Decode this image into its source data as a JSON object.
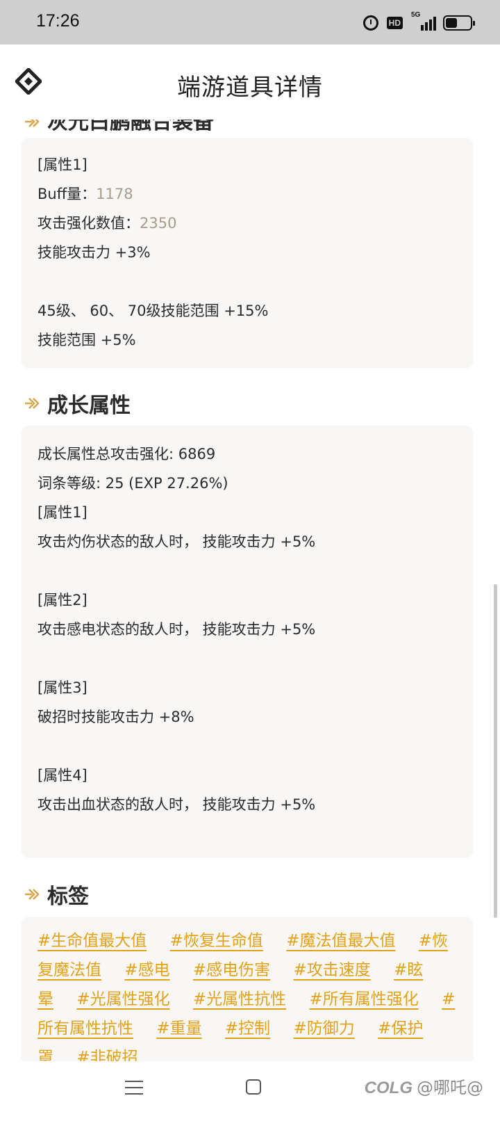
{
  "status": {
    "time": "17:26",
    "hd": "HD",
    "network": "5G"
  },
  "header": {
    "title": "端游道具详情"
  },
  "cut_heading": "灰光白鹏融合装备",
  "card1": {
    "lines": [
      {
        "label": "[属性1]",
        "value": ""
      },
      {
        "label": "Buff量：",
        "value": "1178"
      },
      {
        "label": "攻击强化数值：",
        "value": "2350"
      },
      {
        "label": "技能攻击力 +3%",
        "value": ""
      },
      {
        "label": "",
        "value": ""
      },
      {
        "label": "45级、 60、 70级技能范围 +15%",
        "value": ""
      },
      {
        "label": "技能范围 +5%",
        "value": ""
      }
    ]
  },
  "growth": {
    "title": "成长属性",
    "lines": [
      "成长属性总攻击强化: 6869",
      "词条等级: 25 (EXP 27.26%)",
      "[属性1]",
      "攻击灼伤状态的敌人时， 技能攻击力 +5%",
      "",
      "[属性2]",
      "攻击感电状态的敌人时， 技能攻击力 +5%",
      "",
      "[属性3]",
      "破招时技能攻击力 +8%",
      "",
      "[属性4]",
      "攻击出血状态的敌人时， 技能攻击力 +5%"
    ]
  },
  "tags_section": {
    "title": "标签",
    "tags": [
      "#生命值最大值",
      "#恢复生命值",
      "#魔法值最大值",
      "#恢复魔法值",
      "#感电",
      "#感电伤害",
      "#攻击速度",
      "#眩晕",
      "#光属性强化",
      "#光属性抗性",
      "#所有属性强化",
      "#所有属性抗性",
      "#重量",
      "#控制",
      "#防御力",
      "#保护罩",
      "#非破招"
    ]
  },
  "watermark": {
    "brand": "COLG",
    "user": "@哪吒@"
  },
  "colors": {
    "accent": "#e3a118",
    "muted": "#a79c8a",
    "card_bg": "#f8f7f5"
  }
}
